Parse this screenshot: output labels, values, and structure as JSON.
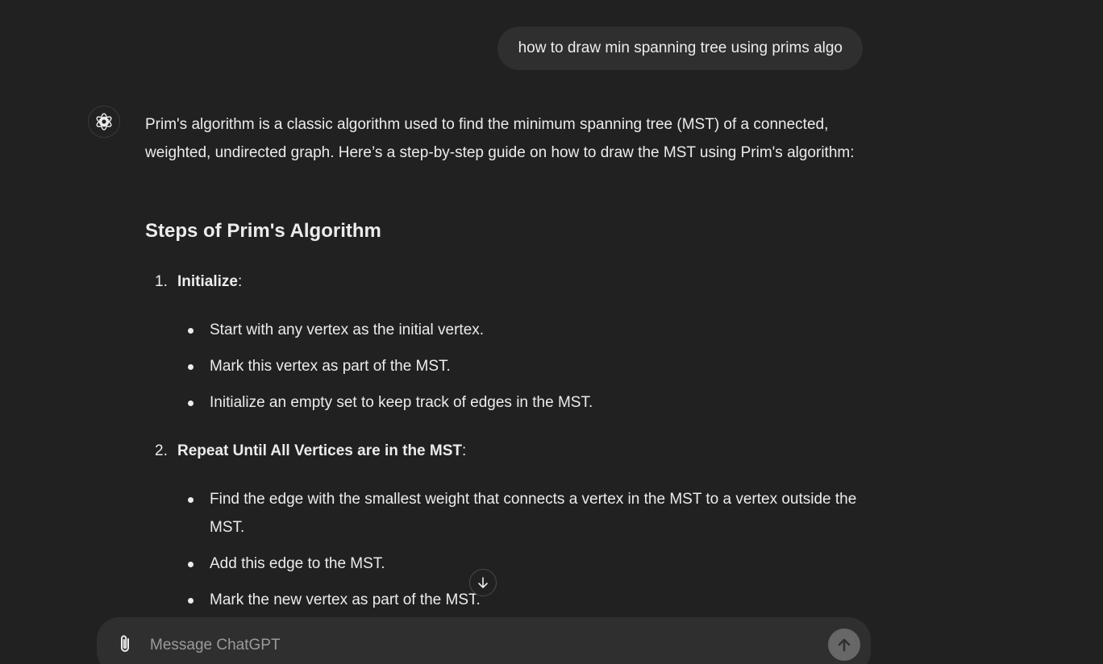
{
  "user_message": "how to draw min spanning tree using prims algo",
  "assistant": {
    "intro": "Prim's algorithm is a classic algorithm used to find the minimum spanning tree (MST) of a connected, weighted, undirected graph. Here’s a step-by-step guide on how to draw the MST using Prim's algorithm:",
    "heading": "Steps of Prim's Algorithm",
    "steps": [
      {
        "number": "1.",
        "title": "Initialize",
        "suffix": ":",
        "bullets": [
          "Start with any vertex as the initial vertex.",
          "Mark this vertex as part of the MST.",
          "Initialize an empty set to keep track of edges in the MST."
        ]
      },
      {
        "number": "2.",
        "title": "Repeat Until All Vertices are in the MST",
        "suffix": ":",
        "bullets": [
          "Find the edge with the smallest weight that connects a vertex in the MST to a vertex outside the MST.",
          "Add this edge to the MST.",
          "Mark the new vertex as part of the MST."
        ]
      }
    ]
  },
  "composer": {
    "placeholder": "Message ChatGPT"
  },
  "icons": {
    "assistant_avatar": "openai-logo-icon",
    "scroll": "arrow-down-icon",
    "attach": "paperclip-icon",
    "send": "arrow-up-icon"
  },
  "colors": {
    "background": "#212121",
    "bubble": "#2f2f2f",
    "text": "#ececec",
    "send_button": "#676767"
  }
}
